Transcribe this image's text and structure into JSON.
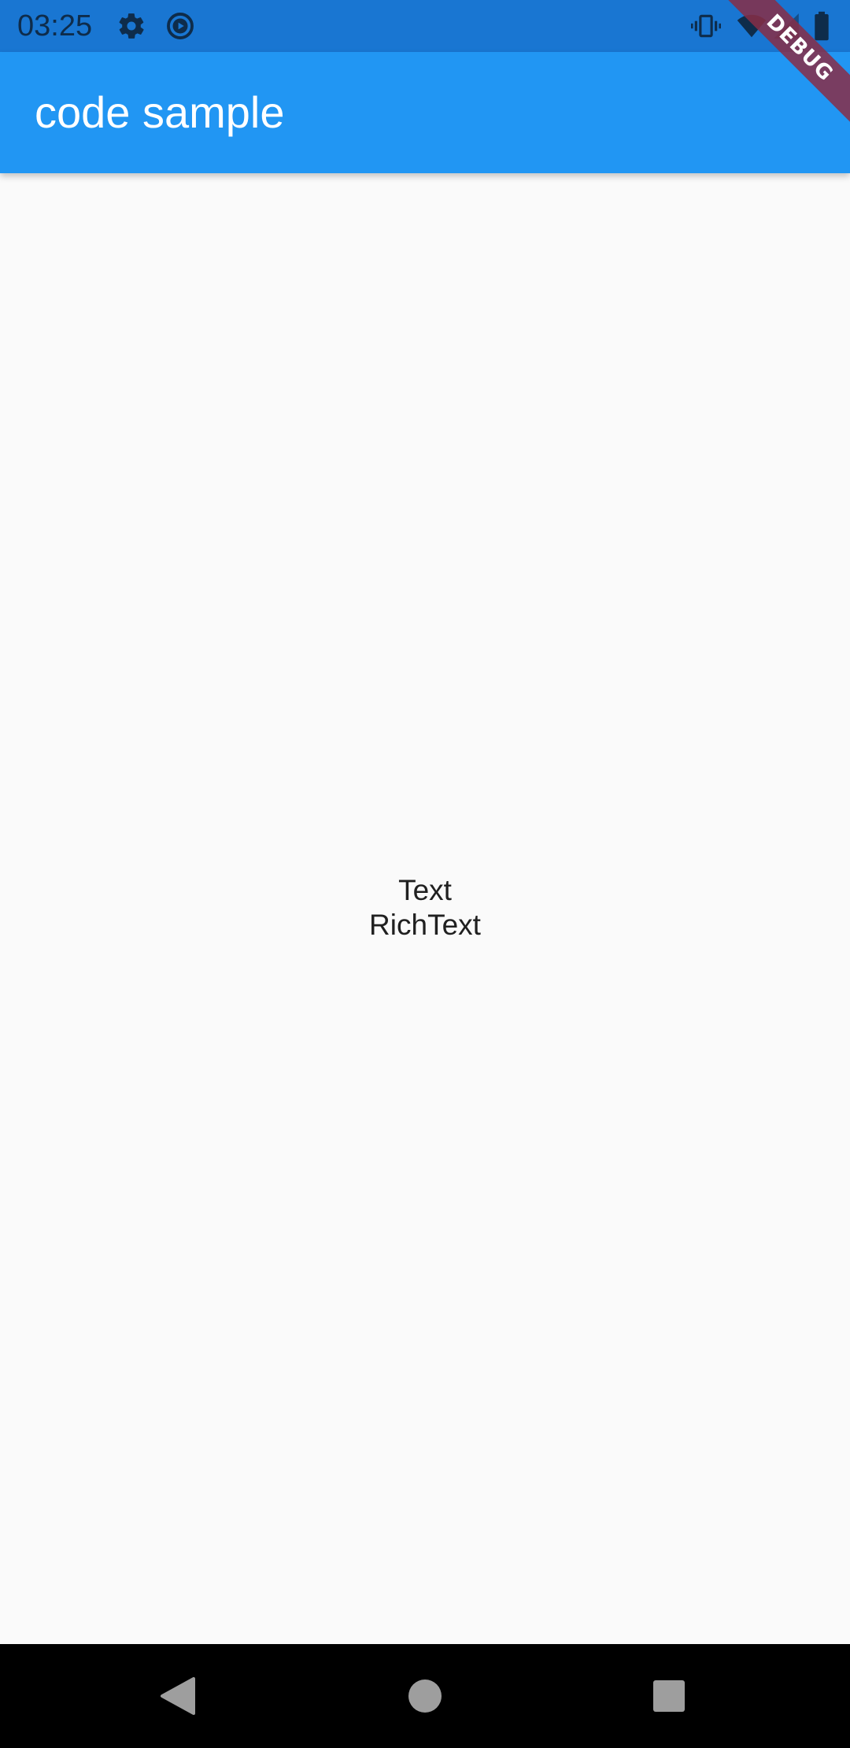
{
  "status_bar": {
    "time": "03:25",
    "icons": [
      "gear-icon",
      "play-circle-icon",
      "vibrate-icon",
      "wifi-icon",
      "signal-icon",
      "battery-icon"
    ],
    "color": "#1976d2"
  },
  "app_bar": {
    "title": "code sample",
    "color": "#2196f3"
  },
  "body": {
    "text_line": "Text",
    "rich_text_line": "RichText"
  },
  "debug_banner": {
    "label": "DEBUG"
  },
  "nav_bar": {
    "icons": [
      "back-icon",
      "home-icon",
      "recents-icon"
    ]
  }
}
